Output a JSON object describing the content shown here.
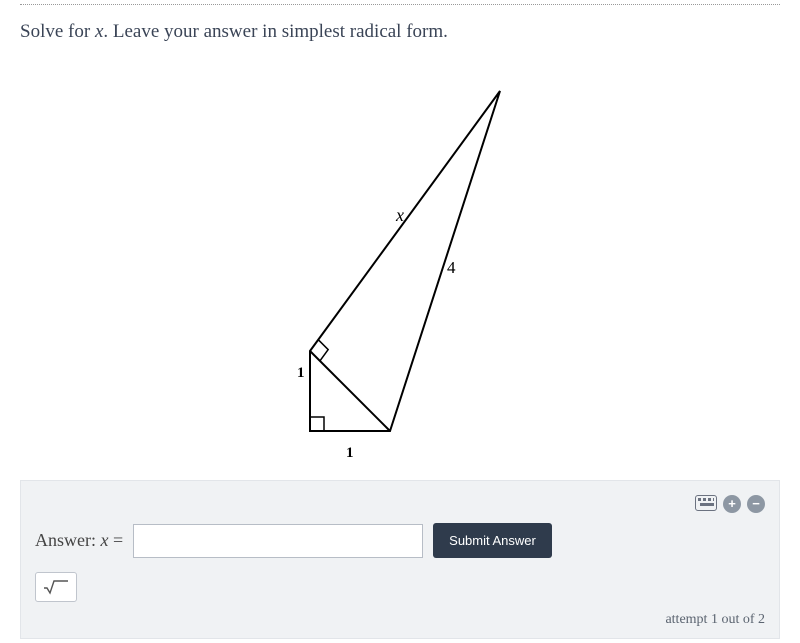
{
  "question": {
    "prefix": "Solve for ",
    "var": "x",
    "suffix": ". Leave your answer in simplest radical form."
  },
  "figure": {
    "labels": {
      "hyp_leg": "x",
      "hypotenuse": "4",
      "short1": "1",
      "short2": "1"
    }
  },
  "answer": {
    "label_prefix": "Answer:  ",
    "var": "x",
    "equals": " =",
    "value": "",
    "placeholder": ""
  },
  "buttons": {
    "submit": "Submit Answer"
  },
  "footer": {
    "attempt": "attempt 1 out of 2"
  }
}
